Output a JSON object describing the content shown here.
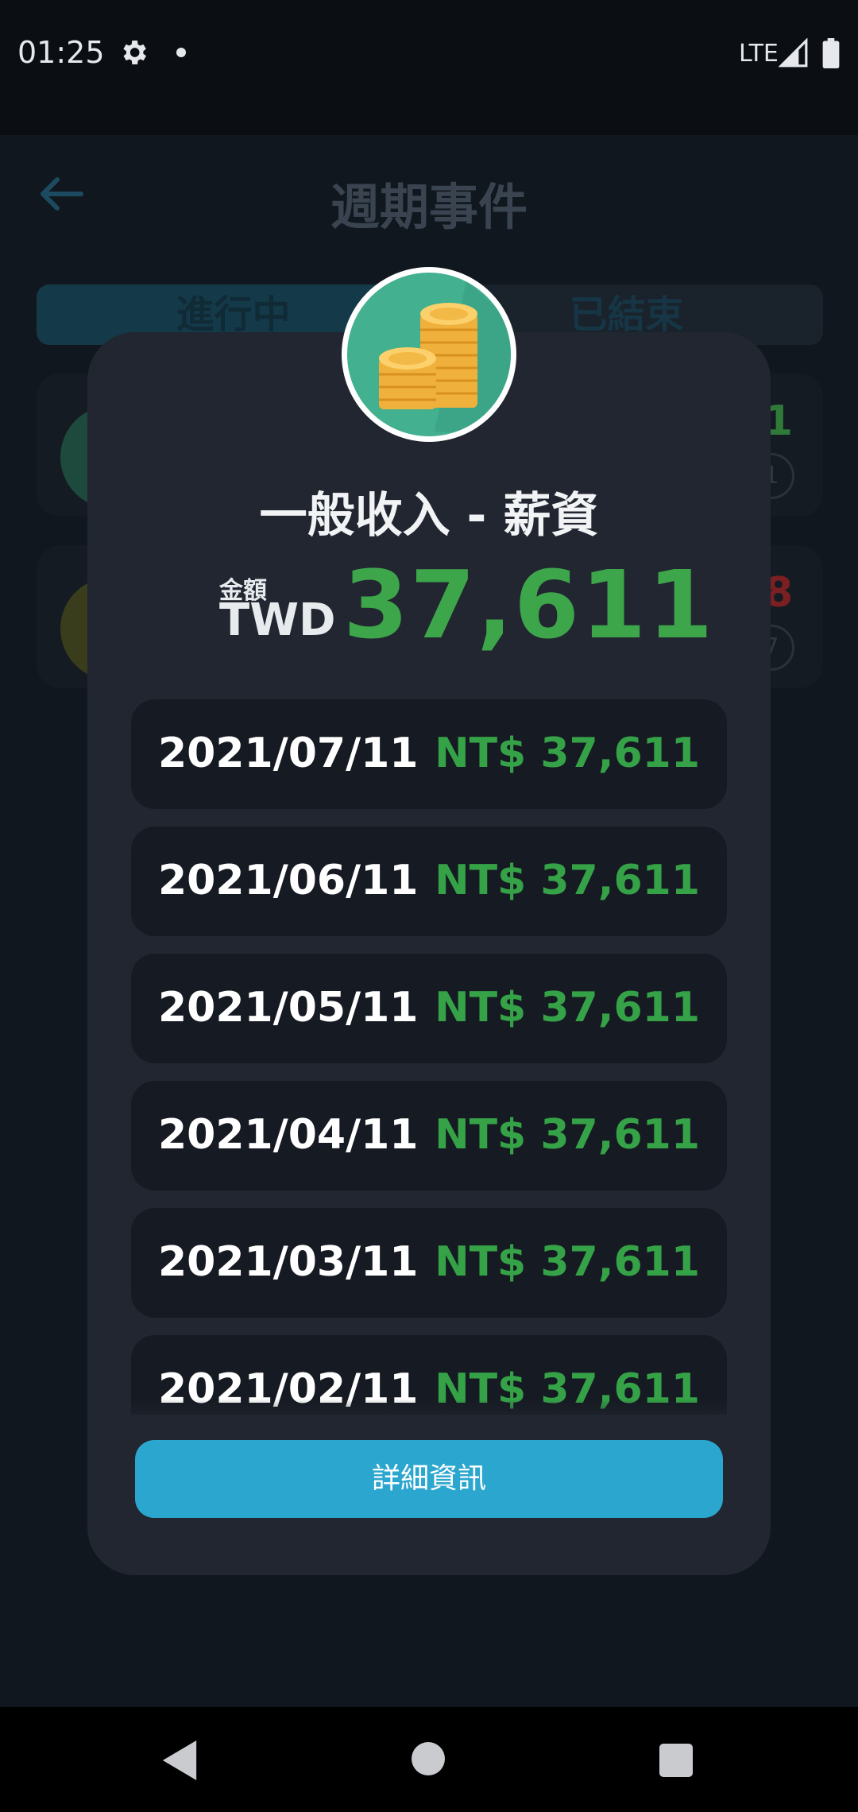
{
  "status_bar": {
    "time": "01:25",
    "network": "LTE",
    "icons": [
      "gear-icon",
      "dot-icon",
      "signal-icon",
      "battery-icon"
    ]
  },
  "background_screen": {
    "title": "週期事件",
    "tabs": [
      {
        "label": "進行中",
        "active": true
      },
      {
        "label": "已結束",
        "active": false
      }
    ],
    "cards": [
      {
        "amount_fragment": "1",
        "badge_fragment": "1",
        "amount_color": "#2f7a38"
      },
      {
        "amount_fragment": "8",
        "badge_fragment": "7",
        "amount_color": "#7a1f22"
      }
    ]
  },
  "dialog": {
    "icon": "coin-stack-icon",
    "title": "一般收入 -  薪資",
    "amount_label": "金額",
    "currency": "TWD",
    "amount": "37,611",
    "records": [
      {
        "date": "2021/07/11",
        "amount": "NT$ 37,611"
      },
      {
        "date": "2021/06/11",
        "amount": "NT$ 37,611"
      },
      {
        "date": "2021/05/11",
        "amount": "NT$ 37,611"
      },
      {
        "date": "2021/04/11",
        "amount": "NT$ 37,611"
      },
      {
        "date": "2021/03/11",
        "amount": "NT$ 37,611"
      },
      {
        "date": "2021/02/11",
        "amount": "NT$ 37,611"
      }
    ],
    "detail_button_label": "詳細資訊"
  },
  "colors": {
    "accent_green": "#3ea64a",
    "button_blue": "#2ba6cf",
    "dialog_bg": "#212631",
    "record_bg": "#161a22"
  },
  "nav_bar": {
    "icons": [
      "back-icon",
      "home-icon",
      "recents-icon"
    ]
  }
}
